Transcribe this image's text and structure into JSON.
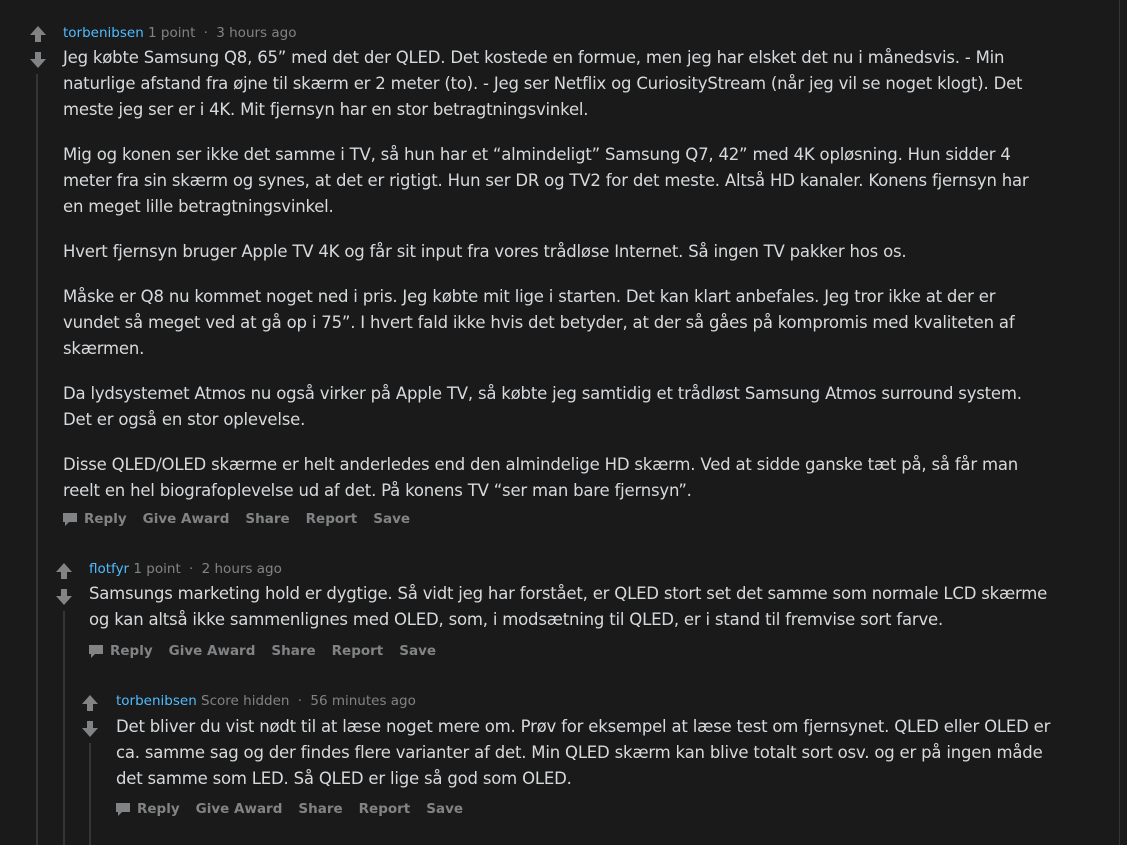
{
  "comments": [
    {
      "author": "torbenibsen",
      "score": "1 point",
      "time": "3 hours ago",
      "paragraphs": [
        "Jeg købte Samsung Q8, 65” med det der QLED. Det kostede en formue, men jeg har elsket det nu i månedsvis. - Min naturlige afstand fra øjne til skærm er 2 meter (to). - Jeg ser Netflix og CuriosityStream (når jeg vil se noget klogt). Det meste jeg ser er i 4K. Mit fjernsyn har en stor betragtningsvinkel.",
        "Mig og konen ser ikke det samme i TV, så hun har et “almindeligt” Samsung Q7, 42” med 4K opløsning. Hun sidder 4 meter fra sin skærm og synes, at det er rigtigt. Hun ser DR og TV2 for det meste. Altså HD kanaler. Konens fjernsyn har en meget lille betragtningsvinkel.",
        "Hvert fjernsyn bruger Apple TV 4K og får sit input fra vores trådløse Internet. Så ingen TV pakker hos os.",
        "Måske er Q8 nu kommet noget ned i pris. Jeg købte mit lige i starten. Det kan klart anbefales. Jeg tror ikke at der er vundet så meget ved at gå op i 75”. I hvert fald ikke hvis det betyder, at der så gåes på kompromis med kvaliteten af skærmen.",
        "Da lydsystemet Atmos nu også virker på Apple TV, så købte jeg samtidig et trådløst Samsung Atmos surround system. Det er også en stor oplevelse.",
        "Disse QLED/OLED skærme er helt anderledes end den almindelige HD skærm. Ved at sidde ganske tæt på, så får man reelt en hel biografoplevelse ud af det. På konens TV “ser man bare fjernsyn”."
      ]
    },
    {
      "author": "flotfyr",
      "score": "1 point",
      "time": "2 hours ago",
      "paragraphs": [
        "Samsungs marketing hold er dygtige. Så vidt jeg har forstået, er QLED stort set det samme som normale LCD skærme og kan altså ikke sammenlignes med OLED, som, i modsætning til QLED, er i stand til fremvise sort farve."
      ]
    },
    {
      "author": "torbenibsen",
      "score": "Score hidden",
      "time": "56 minutes ago",
      "paragraphs": [
        "Det bliver du vist nødt til at læse noget mere om. Prøv for eksempel at læse test om fjernsynet. QLED eller OLED er ca. samme sag og der findes flere varianter af det. Min QLED skærm kan blive totalt sort osv. og er på ingen måde det samme som LED. Så QLED er lige så god som OLED."
      ]
    }
  ],
  "actions": {
    "reply": "Reply",
    "give_award": "Give Award",
    "share": "Share",
    "report": "Report",
    "save": "Save"
  },
  "separator": "·",
  "icons": {
    "upvote": "upvote-arrow-icon",
    "downvote": "downvote-arrow-icon",
    "reply": "speech-bubble-icon"
  },
  "colors": {
    "background": "#1a1a1b",
    "author": "#4fbcff",
    "body_text": "#d7dadc",
    "meta_text": "#818384",
    "thread_line": "#343536"
  }
}
